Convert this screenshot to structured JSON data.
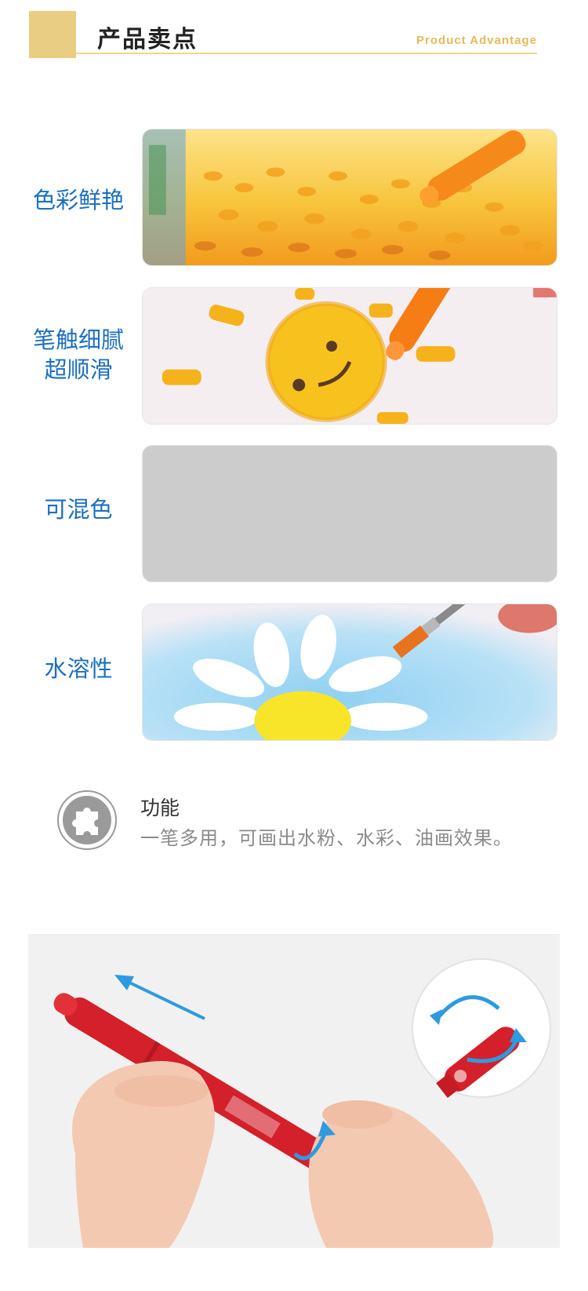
{
  "header": {
    "title": "产品卖点",
    "subtitle": "Product Advantage"
  },
  "features": [
    {
      "label": "色彩鲜艳"
    },
    {
      "label": "笔触细腻\n超顺滑"
    },
    {
      "label": "可混色"
    },
    {
      "label": "水溶性"
    }
  ],
  "function": {
    "title": "功能",
    "description": "一笔多用，可画出水粉、水彩、油画效果。"
  },
  "colors": {
    "accent_gold": "#e9cd82",
    "label_blue": "#1b6fc0",
    "crayon_red": "#d4202a",
    "arrow_blue": "#2e9ae0"
  }
}
